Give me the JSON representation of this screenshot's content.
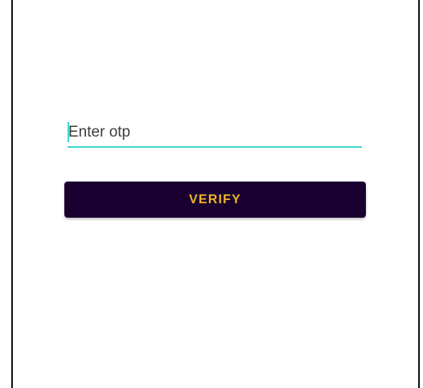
{
  "otp": {
    "placeholder": "Enter otp",
    "value": ""
  },
  "verify": {
    "label": "VERIFY"
  },
  "colors": {
    "accent_underline": "#3fd6c8",
    "button_background": "#1a0030",
    "button_text": "#f0b429"
  }
}
